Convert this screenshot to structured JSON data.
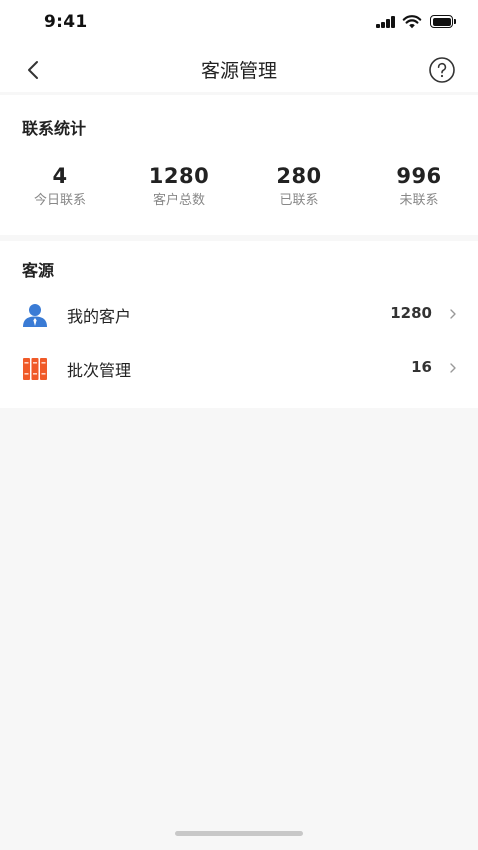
{
  "status_bar": {
    "time": "9:41",
    "icons": [
      "cellular-signal-icon",
      "wifi-icon",
      "battery-icon"
    ]
  },
  "nav": {
    "title": "客源管理",
    "back_icon": "chevron-left-icon",
    "help_icon": "question-circle-icon"
  },
  "stats": {
    "title": "联系统计",
    "items": [
      {
        "value": "4",
        "label": "今日联系"
      },
      {
        "value": "1280",
        "label": "客户总数"
      },
      {
        "value": "280",
        "label": "已联系"
      },
      {
        "value": "996",
        "label": "未联系"
      }
    ]
  },
  "source": {
    "title": "客源",
    "items": [
      {
        "label": "我的客户",
        "count": "1280",
        "icon": "person-icon"
      },
      {
        "label": "批次管理",
        "count": "16",
        "icon": "binders-icon"
      }
    ]
  },
  "colors": {
    "person_icon": "#3a7bd5",
    "binders_icon": "#f05a28",
    "background": "#f7f7f7",
    "card": "#ffffff"
  }
}
